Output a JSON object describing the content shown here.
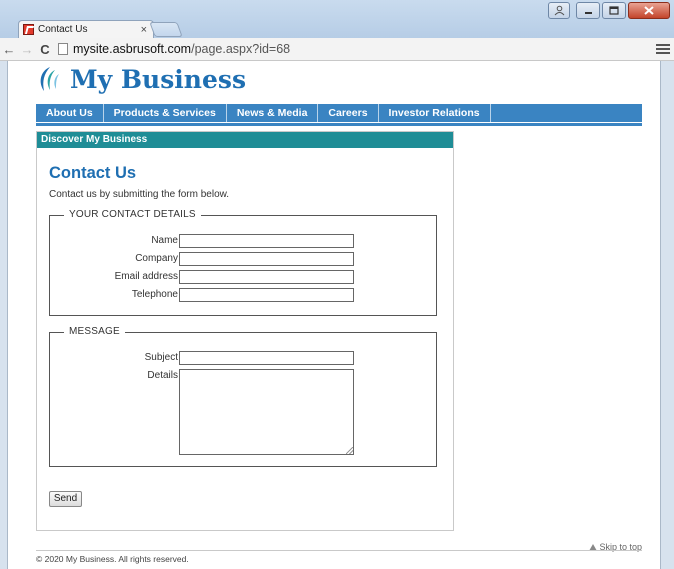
{
  "browser": {
    "tab_title": "Contact Us",
    "tab_close": "×",
    "url_host": "mysite.asbrusoft.com",
    "url_path": "/page.aspx?id=68",
    "icons": [
      "back-arrow-icon",
      "forward-arrow-icon",
      "reload-icon",
      "page-icon",
      "menu-icon"
    ]
  },
  "site": {
    "logo_text": "My Business",
    "brand_color": "#1f6fb2",
    "nav": [
      "About Us",
      "Products & Services",
      "News & Media",
      "Careers",
      "Investor Relations"
    ],
    "nav_color": "#3a84c2"
  },
  "panel": {
    "header": "Discover My Business",
    "header_color": "#1f8d96",
    "title": "Contact Us",
    "intro": "Contact us by submitting the form below."
  },
  "form": {
    "contact_legend": "YOUR CONTACT DETAILS",
    "contact_fields": {
      "name": "Name",
      "company": "Company",
      "email": "Email address",
      "telephone": "Telephone"
    },
    "message_legend": "MESSAGE",
    "message_fields": {
      "subject": "Subject",
      "details": "Details"
    },
    "submit": "Send"
  },
  "footer": {
    "skip": "Skip to top",
    "copyright": "© 2020 My Business. All rights reserved."
  }
}
